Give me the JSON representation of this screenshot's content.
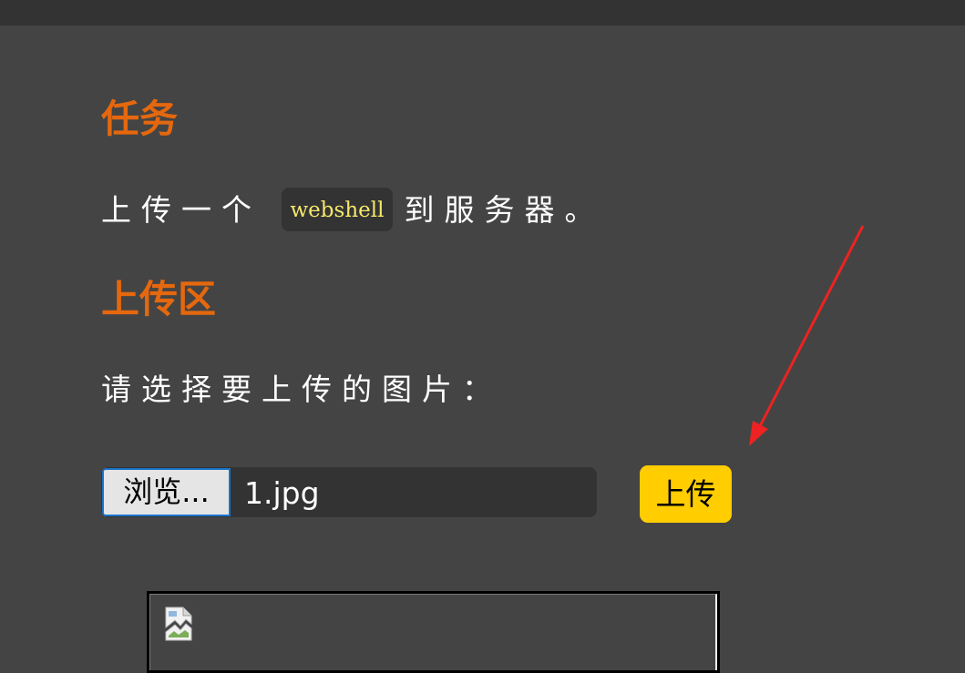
{
  "task": {
    "heading": "任务",
    "text_before": "上传一个",
    "code": "webshell",
    "text_after": "到服务器。"
  },
  "upload": {
    "heading": "上传区",
    "prompt": "请选择要上传的图片：",
    "browse_label": "浏览...",
    "file_name": "1.jpg",
    "submit_label": "上传"
  },
  "preview": {
    "icon": "broken-image-icon"
  },
  "annotation": {
    "icon": "red-arrow-icon",
    "color": "#ee2222"
  },
  "colors": {
    "background": "#444444",
    "heading": "#e5680e",
    "code_text": "#f5e86a",
    "upload_button": "#ffcd00"
  }
}
